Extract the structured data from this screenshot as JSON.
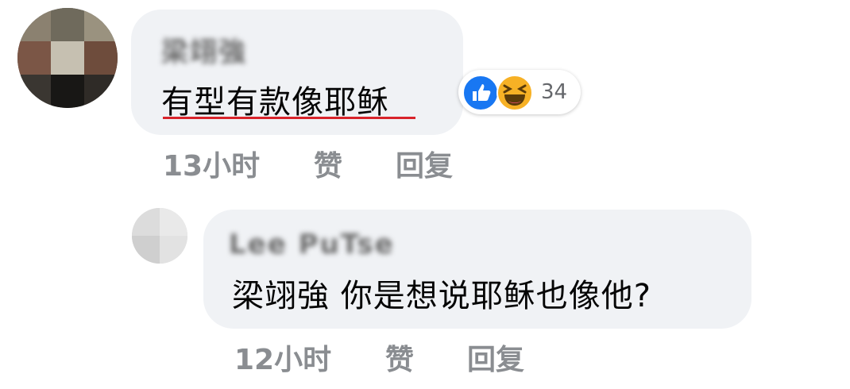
{
  "comments": [
    {
      "author": "梁翊強",
      "text": "有型有款像耶稣",
      "reactions": {
        "icons": [
          "like-icon",
          "haha-icon"
        ],
        "count": "34"
      },
      "time": "13小时",
      "like_label": "赞",
      "reply_label": "回复"
    }
  ],
  "replies": [
    {
      "author": "Lee PuTse",
      "text": "梁翊強 你是想说耶稣也像他?",
      "time": "12小时",
      "like_label": "赞",
      "reply_label": "回复"
    }
  ],
  "colors": {
    "bubble": "#f0f2f5",
    "meta_text": "#8a8d91",
    "like_blue": "#1877f2",
    "haha_yellow": "#f7b125",
    "underline_red": "#d8232a"
  }
}
